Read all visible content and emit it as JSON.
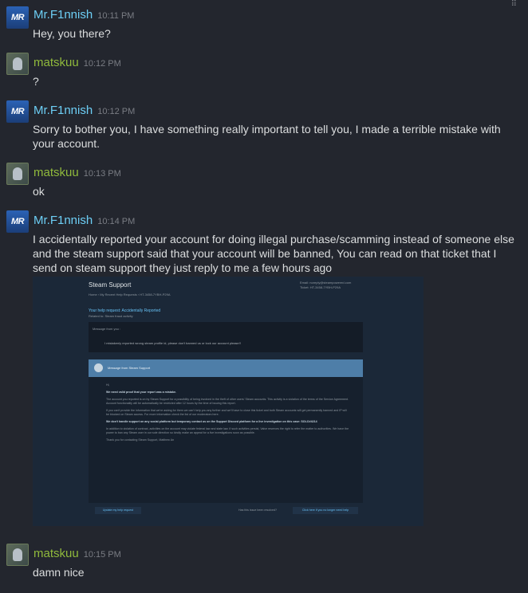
{
  "messages": [
    {
      "author": "Mr.F1nnish",
      "time": "10:11 PM",
      "text": "Hey, you there?"
    },
    {
      "author": "matskuu",
      "time": "10:12 PM",
      "text": "?"
    },
    {
      "author": "Mr.F1nnish",
      "time": "10:12 PM",
      "text": "Sorry to bother you, I have something really important to tell you, I made a terrible mistake with your account."
    },
    {
      "author": "matskuu",
      "time": "10:13 PM",
      "text": "ok"
    },
    {
      "author": "Mr.F1nnish",
      "time": "10:14 PM",
      "text": "I accidentally reported your account for doing illegal purchase/scamming instead of someone else and the steam support said that your account will be banned, You can read on that ticket that I send on steam support they just reply to me a few hours ago"
    },
    {
      "author": "matskuu",
      "time": "10:15 PM",
      "text": "damn nice"
    }
  ],
  "avatars": {
    "mr_initials": "MR"
  },
  "corner_glyph": "⠿",
  "ticket": {
    "title": "Steam Support",
    "email": "Email: noreply@steampowered.com",
    "ticket_no": "Ticket: HT-3458-7YBH-P29A",
    "breadcrumb": "Home › My Recent Help Requests › HT-3458-7YBH-P29A",
    "request_title": "Your help request: Accidentally Reported",
    "related": "Related to: Steam fraud activity",
    "from_label": "Message from you :",
    "from_text": "I mistakenly reported wrong steam profile id, please don't banned us or lock our account please!!",
    "header": "Message from Steam Support",
    "greeting": "Hi,",
    "valid_proof": "We need valid proof that your report was a mistake.",
    "para1": "The account you reported is on by Steam Support for a possibility of being involved in the theft of other users' Steam accounts. This activity is a violation of the terms of the Service Agreement. Account functionality will be automatically be restricted after 12 hours by the time of issuing this report.",
    "para2": "If you can't provide the information that we're asking for them we can't help you any further and we'll have to close this ticket and both Steam accounts will get permanently banned and IP will be blocked on Steam access. For more information check the list of our moderators here.",
    "para3": "We don't handle support on any social platform but temporary contact us on the Support Discord platform for a live investigation on this case: SOLO#4214",
    "para4": "In addition to violation of contract, activities on the account may violate federal law and state law. If such activities persist, Valve reserves the right to refer the matter to authorities. We have the power to ban any Steam user in our sole direction so kindly make an appeal for a live investigations soon as possible.",
    "thanks": "Thank you for contacting Steam Support, Matthew An",
    "update_btn": "Update my help request",
    "resolved_q": "Has this issue been resolved?",
    "close_btn": "Click here if you no longer need help"
  }
}
